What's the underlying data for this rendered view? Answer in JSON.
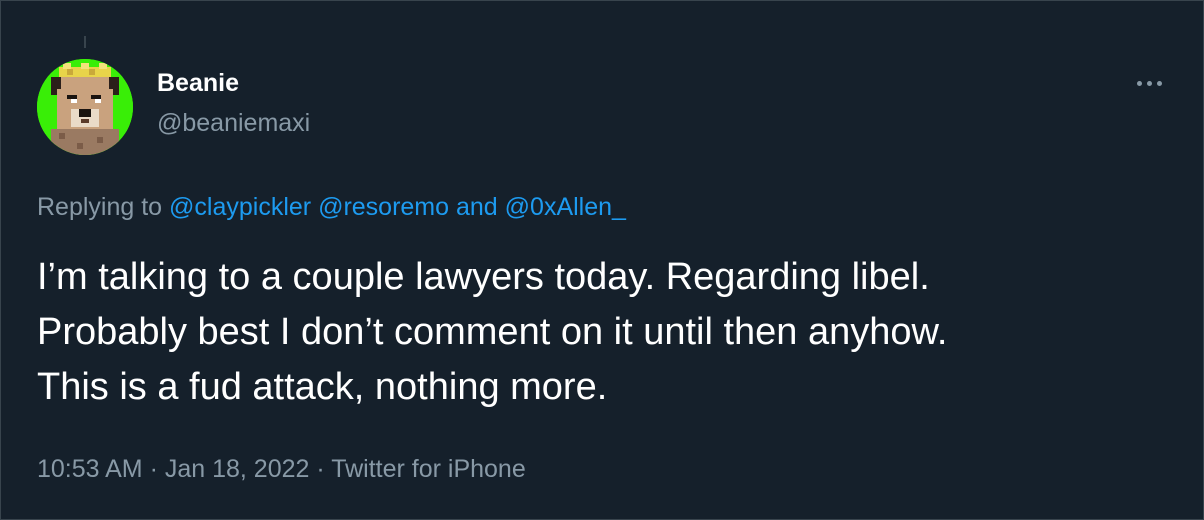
{
  "colors": {
    "background": "#15202b",
    "text_primary": "#ffffff",
    "text_secondary": "#8899a6",
    "link": "#1d9bf0",
    "avatar_background": "#39ee07"
  },
  "author": {
    "display_name": "Beanie",
    "handle": "@beaniemaxi",
    "avatar_icon": "pixel-dog-avatar"
  },
  "more_icon": "more-options-icon",
  "replying": {
    "prefix": "Replying to ",
    "mentions": [
      "@claypickler",
      "@resoremo"
    ],
    "separator": " and ",
    "last_mention": "@0xAllen_"
  },
  "tweet": {
    "lines": [
      "I’m talking to a couple lawyers today. Regarding libel.",
      "Probably best I don’t comment on it until then anyhow.",
      "This is a fud attack, nothing more."
    ]
  },
  "meta": {
    "time": "10:53 AM",
    "sep1": " · ",
    "date": "Jan 18, 2022",
    "sep2": " · ",
    "source": "Twitter for iPhone"
  }
}
